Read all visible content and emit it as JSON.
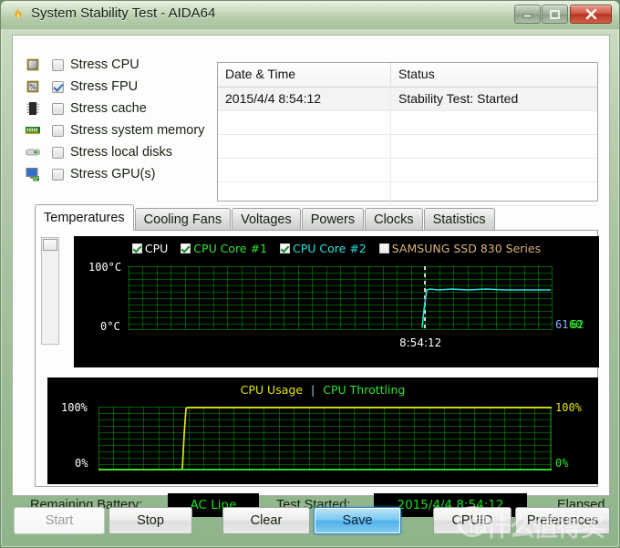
{
  "window": {
    "title": "System Stability Test - AIDA64",
    "icon": "flame-icon",
    "controls": {
      "minimize": "minimize-icon",
      "maximize": "maximize-icon",
      "close": "close-icon"
    }
  },
  "stress_options": [
    {
      "icon": "cpu-chip-icon",
      "label": "Stress CPU",
      "checked": false
    },
    {
      "icon": "fpu-chip-icon",
      "label": "Stress FPU",
      "checked": true
    },
    {
      "icon": "cache-chip-icon",
      "label": "Stress cache",
      "checked": false
    },
    {
      "icon": "memory-stick-icon",
      "label": "Stress system memory",
      "checked": false
    },
    {
      "icon": "hard-disk-icon",
      "label": "Stress local disks",
      "checked": false
    },
    {
      "icon": "gpu-monitor-icon",
      "label": "Stress GPU(s)",
      "checked": false
    }
  ],
  "log": {
    "columns": [
      "Date & Time",
      "Status"
    ],
    "rows": [
      {
        "datetime": "2015/4/4 8:54:12",
        "status": "Stability Test: Started"
      },
      {
        "datetime": "",
        "status": ""
      },
      {
        "datetime": "",
        "status": ""
      },
      {
        "datetime": "",
        "status": ""
      },
      {
        "datetime": "",
        "status": ""
      }
    ]
  },
  "tabs": [
    {
      "label": "Temperatures",
      "active": true
    },
    {
      "label": "Cooling Fans",
      "active": false
    },
    {
      "label": "Voltages",
      "active": false
    },
    {
      "label": "Powers",
      "active": false
    },
    {
      "label": "Clocks",
      "active": false
    },
    {
      "label": "Statistics",
      "active": false
    }
  ],
  "chart_data": [
    {
      "type": "line",
      "name": "temperatures-graph",
      "title": "",
      "ylabel": "",
      "ytick_labels": [
        "100°C",
        "0°C"
      ],
      "ylim": [
        0,
        100
      ],
      "grid": true,
      "grid_color": "#00b400",
      "background": "#000000",
      "time_marker": "8:54:12",
      "legend_position": "top-center",
      "legend": [
        {
          "label": "CPU",
          "color": "#ffffff",
          "checked": true
        },
        {
          "label": "CPU Core #1",
          "color": "#2ee62e",
          "checked": true
        },
        {
          "label": "CPU Core #2",
          "color": "#27e0e0",
          "checked": true
        },
        {
          "label": "SAMSUNG SSD 830 Series",
          "color": "#d8b27a",
          "checked": false
        }
      ],
      "value_labels": [
        {
          "text": "61",
          "color": "#8ab4ff"
        },
        {
          "text": "60",
          "color": "#2ee62e"
        },
        {
          "text": "62",
          "color": "#2ee62e"
        }
      ],
      "series": [
        {
          "name": "CPU Core #2",
          "color": "#27e0e0",
          "x": [
            70,
            72,
            74,
            76,
            80,
            84,
            88,
            92,
            96,
            100
          ],
          "values": [
            0,
            52,
            61,
            62,
            61,
            62,
            61,
            61,
            61,
            61
          ]
        }
      ]
    },
    {
      "type": "line",
      "name": "cpu-usage-graph",
      "title": "",
      "ytick_labels_left": [
        "100%",
        "0%"
      ],
      "ytick_labels_right": [
        "100%",
        "0%"
      ],
      "ylim": [
        0,
        100
      ],
      "grid": true,
      "grid_color": "#00b400",
      "background": "#000000",
      "legend_position": "top-center",
      "legend": [
        {
          "label": "CPU Usage",
          "color": "#e6e600"
        },
        {
          "label": "CPU Throttling",
          "color": "#2ee62e"
        }
      ],
      "series": [
        {
          "name": "CPU Usage",
          "color": "#e6e600",
          "x": [
            0,
            18,
            19,
            20,
            100
          ],
          "values": [
            0,
            0,
            55,
            100,
            100
          ]
        },
        {
          "name": "CPU Throttling",
          "color": "#2ee62e",
          "x": [
            0,
            100
          ],
          "values": [
            0,
            0
          ]
        }
      ]
    }
  ],
  "status": {
    "battery_label": "Remaining Battery:",
    "battery_value": "AC Line",
    "started_label": "Test Started:",
    "started_value": "2015/4/4 8:54:12",
    "elapsed_label": "Elapsed T"
  },
  "buttons": [
    {
      "label": "Start",
      "state": "disabled"
    },
    {
      "label": "Stop",
      "state": "normal"
    },
    {
      "label": "Clear",
      "state": "normal"
    },
    {
      "label": "Save",
      "state": "primary"
    },
    {
      "label": "CPUID",
      "state": "normal"
    },
    {
      "label": "Preferences",
      "state": "normal"
    }
  ],
  "watermark": {
    "text": "什么值得买"
  }
}
